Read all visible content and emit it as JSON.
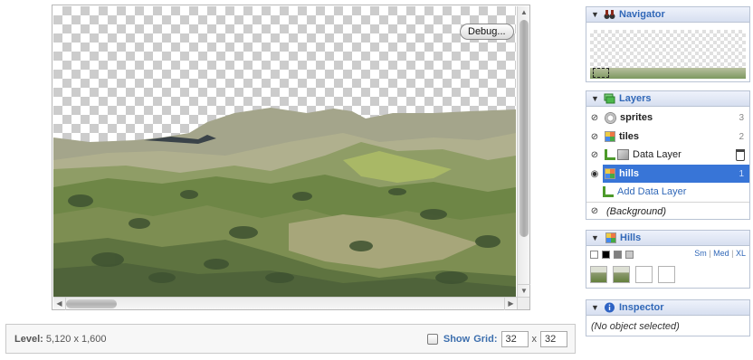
{
  "canvas": {
    "debug_label": "Debug..."
  },
  "status_bar": {
    "level_label": "Level:",
    "level_size": "5,120 x 1,600",
    "show_label": "Show",
    "grid_label": "Grid:",
    "grid_width": "32",
    "grid_height": "32",
    "grid_separator": "x",
    "show_grid_checked": false
  },
  "navigator": {
    "title": "Navigator",
    "icon": "binoculars-icon"
  },
  "layers": {
    "title": "Layers",
    "icon": "layers-icon",
    "items": [
      {
        "name": "sprites",
        "count": "3",
        "icon": "gear-icon",
        "selected": false
      },
      {
        "name": "tiles",
        "count": "2",
        "icon": "tiles-icon",
        "selected": false
      },
      {
        "name": "Data Layer",
        "count": "",
        "icon": "cube-icon",
        "selected": false
      },
      {
        "name": "hills",
        "count": "1",
        "icon": "tiles-icon",
        "selected": true
      }
    ],
    "add_data_layer_label": "Add Data Layer",
    "background_label": "(Background)"
  },
  "hills": {
    "title": "Hills",
    "icon": "tiles-icon",
    "size_options": [
      "Sm",
      "Med",
      "XL"
    ],
    "size_separator": "|",
    "swatch_colors": [
      "#ffffff",
      "#000000",
      "#808080",
      "#c8c8c8"
    ]
  },
  "inspector": {
    "title": "Inspector",
    "icon": "info-icon",
    "empty_text": "(No object selected)"
  },
  "colors": {
    "accent": "#3168b8",
    "selection": "#3875d7",
    "checker": "#cccccc"
  }
}
